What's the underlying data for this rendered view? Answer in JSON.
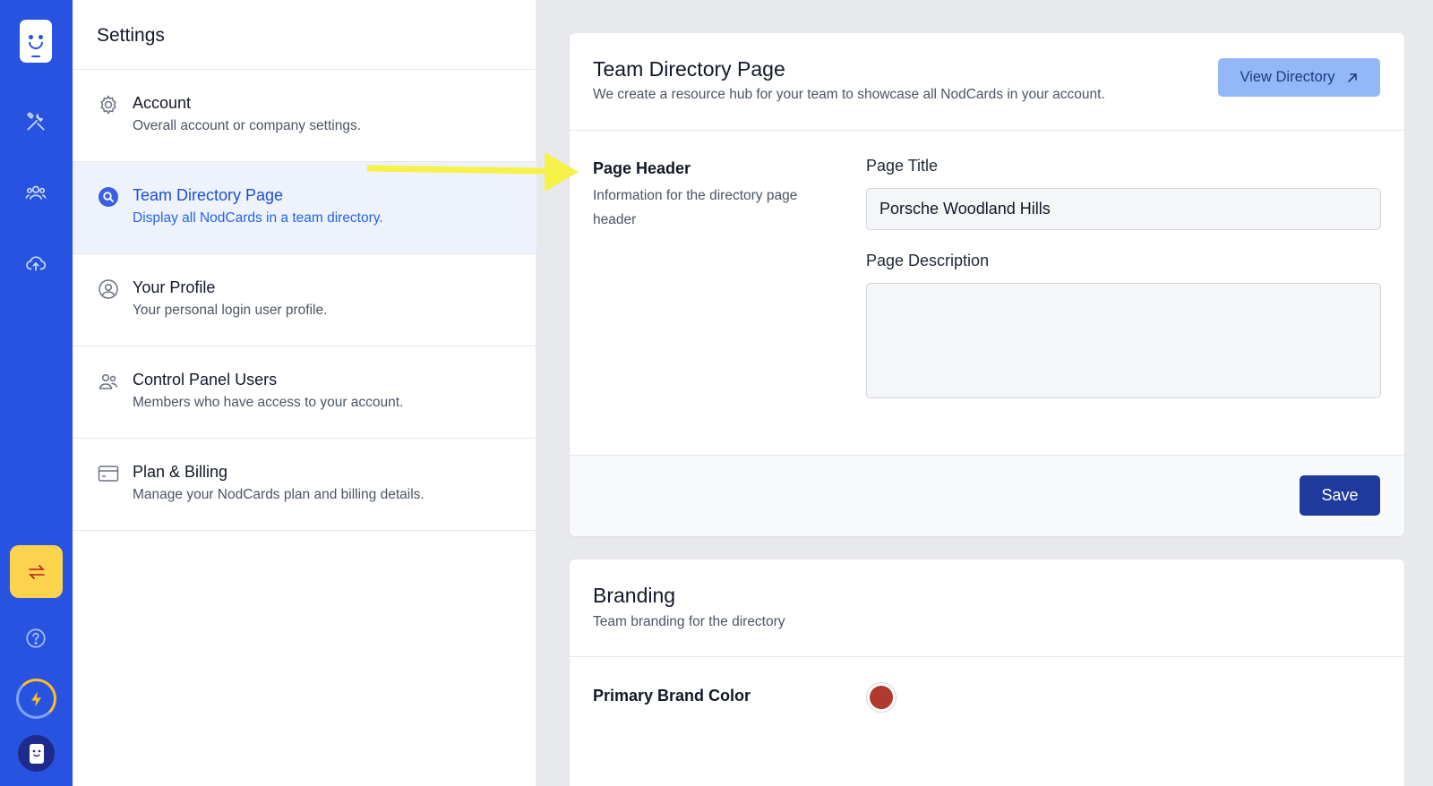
{
  "settings": {
    "title": "Settings",
    "items": [
      {
        "label": "Account",
        "desc": "Overall account or company settings.",
        "icon": "gear-icon"
      },
      {
        "label": "Team Directory Page",
        "desc": "Display all NodCards in a team directory.",
        "icon": "search-circle-icon",
        "active": true
      },
      {
        "label": "Your Profile",
        "desc": "Your personal login user profile.",
        "icon": "user-circle-icon"
      },
      {
        "label": "Control Panel Users",
        "desc": "Members who have access to your account.",
        "icon": "users-icon"
      },
      {
        "label": "Plan & Billing",
        "desc": "Manage your NodCards plan and billing details.",
        "icon": "credit-card-icon"
      }
    ]
  },
  "main": {
    "directory_card": {
      "title": "Team Directory Page",
      "subtitle": "We create a resource hub for your team to showcase all NodCards in your account.",
      "view_button": "View Directory",
      "section_title": "Page Header",
      "section_desc": "Information for the directory page header",
      "page_title_label": "Page Title",
      "page_title_value": "Porsche Woodland Hills",
      "page_desc_label": "Page Description",
      "page_desc_value": "",
      "save_label": "Save"
    },
    "branding_card": {
      "title": "Branding",
      "subtitle": "Team branding for the directory",
      "primary_color_label": "Primary Brand Color",
      "primary_color": "#b03a2e"
    }
  },
  "colors": {
    "rail": "#2853e0",
    "accent": "#1e3a9c",
    "switch_button": "#fcd34d",
    "annotation_arrow": "#f7f24a"
  }
}
